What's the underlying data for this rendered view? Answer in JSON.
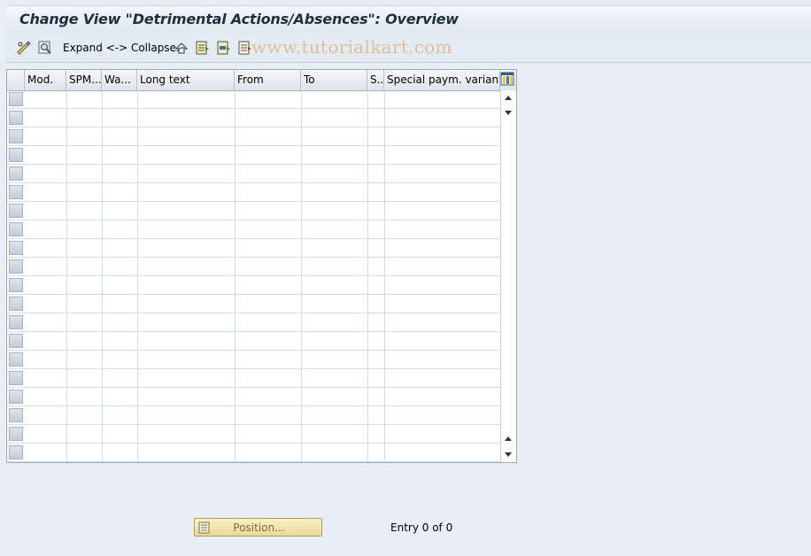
{
  "title": "Change View \"Detrimental Actions/Absences\": Overview",
  "toolbar": {
    "expand_collapse": "Expand <-> Collapse",
    "watermark": "www.tutorialkart.com",
    "icons": [
      "edit-glasses-icon",
      "display-change-icon",
      "undo-icon",
      "select-all-icon",
      "select-block-icon",
      "deselect-icon"
    ]
  },
  "table": {
    "columns": [
      "Mod.",
      "SPM...",
      "Wa...",
      "Long text",
      "From",
      "To",
      "S..",
      "Special paym. variant"
    ],
    "rows": [],
    "visible_empty_rows": 20
  },
  "footer": {
    "position_button": "Position...",
    "entry_text": "Entry 0 of 0"
  }
}
